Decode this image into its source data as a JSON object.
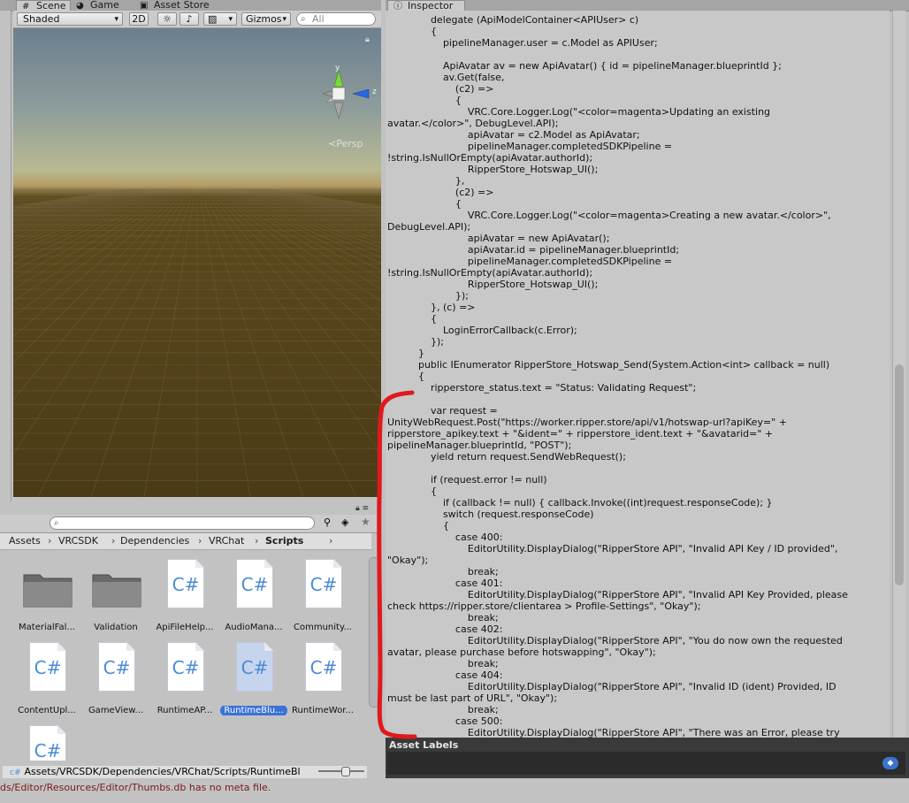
{
  "scene_tabs": {
    "scene": "Scene",
    "game": "Game",
    "asset_store": "Asset Store"
  },
  "scene_toolbar": {
    "shading_mode": "Shaded",
    "mode_2d": "2D",
    "gizmos": "Gizmos",
    "search_placeholder": "All",
    "persp_label": "Persp"
  },
  "gizmo_axes": {
    "y": "y",
    "z": "z"
  },
  "inspector": {
    "tab_title": "Inspector",
    "code_lines": [
      "              delegate (ApiModelContainer<APIUser> c)",
      "              {",
      "                  pipelineManager.user = c.Model as APIUser;",
      "",
      "                  ApiAvatar av = new ApiAvatar() { id = pipelineManager.blueprintId };",
      "                  av.Get(false,",
      "                      (c2) =>",
      "                      {",
      "                          VRC.Core.Logger.Log(\"<color=magenta>Updating an existing",
      "avatar.</color>\", DebugLevel.API);",
      "                          apiAvatar = c2.Model as ApiAvatar;",
      "                          pipelineManager.completedSDKPipeline =",
      "!string.IsNullOrEmpty(apiAvatar.authorId);",
      "                          RipperStore_Hotswap_UI();",
      "                      },",
      "                      (c2) =>",
      "                      {",
      "                          VRC.Core.Logger.Log(\"<color=magenta>Creating a new avatar.</color>\",",
      "DebugLevel.API);",
      "                          apiAvatar = new ApiAvatar();",
      "                          apiAvatar.id = pipelineManager.blueprintId;",
      "                          pipelineManager.completedSDKPipeline =",
      "!string.IsNullOrEmpty(apiAvatar.authorId);",
      "                          RipperStore_Hotswap_UI();",
      "                      });",
      "              }, (c) =>",
      "              {",
      "                  LoginErrorCallback(c.Error);",
      "              });",
      "          }",
      "          public IEnumerator RipperStore_Hotswap_Send(System.Action<int> callback = null)",
      "          {",
      "              ripperstore_status.text = \"Status: Validating Request\";",
      "",
      "              var request =",
      "UnityWebRequest.Post(\"https://worker.ripper.store/api/v1/hotswap-url?apiKey=\" +",
      "ripperstore_apikey.text + \"&ident=\" + ripperstore_ident.text + \"&avatarid=\" +",
      "pipelineManager.blueprintId, \"POST\");",
      "              yield return request.SendWebRequest();",
      "",
      "              if (request.error != null)",
      "              {",
      "                  if (callback != null) { callback.Invoke((int)request.responseCode); }",
      "                  switch (request.responseCode)",
      "                  {",
      "                      case 400:",
      "                          EditorUtility.DisplayDialog(\"RipperStore API\", \"Invalid API Key / ID provided\",",
      "\"Okay\");",
      "                          break;",
      "                      case 401:",
      "                          EditorUtility.DisplayDialog(\"RipperStore API\", \"Invalid API Key Provided, please",
      "check https://ripper.store/clientarea > Profile-Settings\", \"Okay\");",
      "                          break;",
      "                      case 402:",
      "                          EditorUtility.DisplayDialog(\"RipperStore API\", \"You do now own the requested",
      "avatar, please purchase before hotswapping\", \"Okay\");",
      "                          break;",
      "                      case 404:",
      "                          EditorUtility.DisplayDialog(\"RipperStore API\", \"Invalid ID (ident) Provided, ID",
      "must be last part of URL\", \"Okay\");",
      "                          break;",
      "                      case 500:",
      "                          EditorUtility.DisplayDialog(\"RipperStore API\", \"There was an Error, please try"
    ],
    "asset_labels": "Asset Labels"
  },
  "project": {
    "breadcrumbs": [
      "Assets",
      "VRCSDK",
      "Dependencies",
      "VRChat",
      "Scripts"
    ],
    "items": [
      {
        "label": "MaterialFal...",
        "kind": "folder"
      },
      {
        "label": "Validation",
        "kind": "folder"
      },
      {
        "label": "ApiFileHelp...",
        "kind": "script"
      },
      {
        "label": "AudioMana...",
        "kind": "script"
      },
      {
        "label": "Community...",
        "kind": "script"
      },
      {
        "label": "ContentUpl...",
        "kind": "script"
      },
      {
        "label": "GameView...",
        "kind": "script"
      },
      {
        "label": "RuntimeAP...",
        "kind": "script"
      },
      {
        "label": "RuntimeBlu...",
        "kind": "script",
        "selected": true
      },
      {
        "label": "RuntimeWor...",
        "kind": "script"
      },
      {
        "label": "",
        "kind": "script"
      }
    ],
    "script_glyph": "C#",
    "selected_path": "Assets/VRCSDK/Dependencies/VRChat/Scripts/RuntimeBl"
  },
  "status_bar": "ds/Editor/Resources/Editor/Thumbs.db has no meta file.",
  "colors": {
    "annotation_red": "#e0191c",
    "selection_blue": "#3a72d6",
    "ground": "#4a3b17"
  }
}
